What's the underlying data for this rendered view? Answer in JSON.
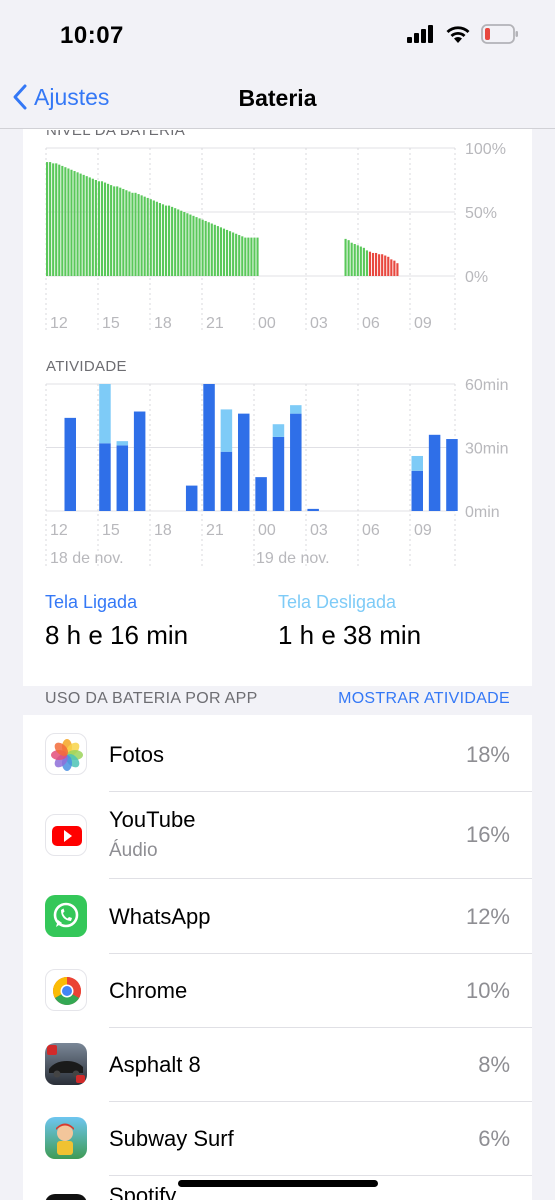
{
  "status": {
    "time": "10:07"
  },
  "nav": {
    "back_label": "Ajustes",
    "title": "Bateria"
  },
  "battery_chart": {
    "section_label": "NÍVEL DA BATERIA",
    "y_labels": [
      "100%",
      "50%",
      "0%"
    ],
    "x_labels": [
      "12",
      "15",
      "18",
      "21",
      "00",
      "03",
      "06",
      "09"
    ]
  },
  "activity_chart": {
    "section_label": "ATIVIDADE",
    "y_labels": [
      "60min",
      "30min",
      "0min"
    ],
    "x_labels": [
      "12",
      "15",
      "18",
      "21",
      "00",
      "03",
      "06",
      "09"
    ],
    "date_labels": [
      "18 de nov.",
      "19 de nov."
    ]
  },
  "chart_data": [
    {
      "type": "bar",
      "title": "NÍVEL DA BATERIA",
      "ylim": [
        0,
        100
      ],
      "x_ticks": [
        "12",
        "15",
        "18",
        "21",
        "00",
        "03",
        "06",
        "09"
      ],
      "colors": {
        "normal": "#5ac85a",
        "low": "#e8483f"
      },
      "segments": [
        {
          "color": "normal",
          "values": [
            89,
            89,
            88,
            88,
            87,
            86,
            85,
            84,
            83,
            82,
            81,
            80,
            79,
            78,
            77,
            76,
            75,
            74,
            74,
            73,
            72,
            71,
            70,
            70,
            69,
            68,
            67,
            66,
            65,
            65,
            64,
            63,
            62,
            61,
            60,
            59,
            58,
            57,
            56,
            55,
            55,
            54,
            53,
            52,
            51,
            50,
            49,
            48,
            47,
            46,
            45,
            44,
            43,
            42,
            41,
            40,
            39,
            38,
            37,
            36,
            35,
            34,
            33,
            32,
            31,
            30,
            30,
            30,
            30,
            30
          ]
        },
        {
          "gap": true,
          "count": 5
        },
        {
          "color": "normal",
          "values": [
            29,
            28,
            26,
            25,
            24,
            23,
            22,
            20
          ]
        },
        {
          "color": "low",
          "values": [
            19,
            18,
            18,
            17,
            17,
            16,
            15,
            13,
            12,
            10
          ]
        }
      ]
    },
    {
      "type": "bar",
      "title": "ATIVIDADE",
      "ylim": [
        0,
        60
      ],
      "y_unit": "min",
      "x_ticks": [
        "12",
        "15",
        "18",
        "21",
        "00",
        "03",
        "06",
        "09"
      ],
      "series": [
        {
          "name": "Tela Ligada",
          "color": "#2f6fe8",
          "values": [
            44,
            0,
            32,
            31,
            47,
            0,
            0,
            12,
            60,
            28,
            46,
            16,
            35,
            46,
            1,
            0,
            0,
            0,
            0,
            0,
            19,
            36,
            34
          ]
        },
        {
          "name": "Tela Desligada",
          "color": "#7ecbf7",
          "values": [
            0,
            0,
            28,
            2,
            0,
            0,
            0,
            0,
            0,
            20,
            0,
            0,
            6,
            4,
            0,
            0,
            0,
            0,
            0,
            0,
            7,
            0,
            0
          ]
        }
      ]
    }
  ],
  "usage": {
    "screen_on_label": "Tela Ligada",
    "screen_on_value": "8 h e 16 min",
    "screen_off_label": "Tela Desligada",
    "screen_off_value": "1 h e 38 min"
  },
  "app_list": {
    "header": "USO DA BATERIA POR APP",
    "action": "MOSTRAR ATIVIDADE",
    "items": [
      {
        "name": "Fotos",
        "sub": "",
        "pct": "18%",
        "icon": "photos-icon"
      },
      {
        "name": "YouTube",
        "sub": "Áudio",
        "pct": "16%",
        "icon": "youtube-icon"
      },
      {
        "name": "WhatsApp",
        "sub": "",
        "pct": "12%",
        "icon": "whatsapp-icon"
      },
      {
        "name": "Chrome",
        "sub": "",
        "pct": "10%",
        "icon": "chrome-icon"
      },
      {
        "name": "Asphalt 8",
        "sub": "",
        "pct": "8%",
        "icon": "asphalt-icon"
      },
      {
        "name": "Subway Surf",
        "sub": "",
        "pct": "6%",
        "icon": "subway-surf-icon"
      },
      {
        "name": "Spotify",
        "sub": "",
        "pct": "",
        "icon": "spotify-icon"
      }
    ]
  },
  "colors": {
    "accent": "#3478f6",
    "screen_off": "#5ac8fa",
    "battery_green": "#5ac85a",
    "battery_red": "#e8483f"
  }
}
